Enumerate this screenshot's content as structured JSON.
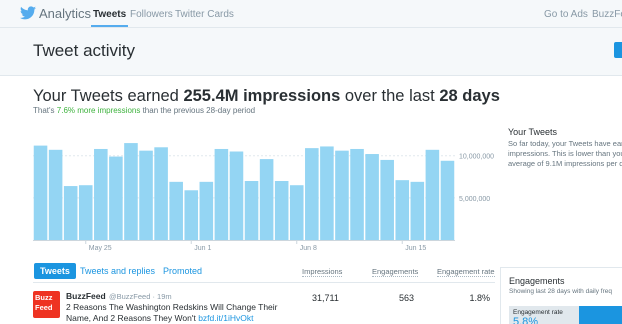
{
  "nav": {
    "brand": "Analytics",
    "tabs": [
      "Tweets",
      "Followers",
      "Twitter Cards"
    ],
    "right": [
      "Go to Ads",
      "BuzzFee"
    ]
  },
  "page": {
    "title": "Tweet activity"
  },
  "summary": {
    "prefix": "Your Tweets earned ",
    "impressions": "255.4M impressions",
    "middle": " over the last ",
    "period": "28 days",
    "compare_prefix": "That's ",
    "compare_delta": "7.6% more impressions",
    "compare_suffix": " than the previous 28-day period"
  },
  "chart_data": {
    "type": "bar",
    "ylabels": [
      "10,000,000",
      "5,000,000"
    ],
    "ytick_values": [
      10000000,
      5000000
    ],
    "xlabels": [
      "May 25",
      "Jun 1",
      "Jun 8",
      "Jun 15"
    ],
    "xlabel_positions": [
      3.5,
      10.5,
      17.5,
      24.5
    ],
    "ylim": [
      0,
      14000000
    ],
    "categories": [
      "May 22",
      "May 23",
      "May 24",
      "May 25",
      "May 26",
      "May 27",
      "May 28",
      "May 29",
      "May 30",
      "May 31",
      "Jun 1",
      "Jun 2",
      "Jun 3",
      "Jun 4",
      "Jun 5",
      "Jun 6",
      "Jun 7",
      "Jun 8",
      "Jun 9",
      "Jun 10",
      "Jun 11",
      "Jun 12",
      "Jun 13",
      "Jun 14",
      "Jun 15",
      "Jun 16",
      "Jun 17",
      "Jun 18"
    ],
    "values": [
      11200000,
      10700000,
      6400000,
      6500000,
      10800000,
      9900000,
      11500000,
      10600000,
      11000000,
      6900000,
      5900000,
      6900000,
      10800000,
      10500000,
      7000000,
      9600000,
      7000000,
      6500000,
      10900000,
      11100000,
      10600000,
      10800000,
      10200000,
      9500000,
      7100000,
      6900000,
      10700000,
      9400000
    ],
    "color": "#94d5f3",
    "grid": "horizontal"
  },
  "side": {
    "title": "Your Tweets",
    "lines": [
      "So far today, your Tweets have earn",
      "impressions. This is lower than you",
      "average of 9.1M impressions per da"
    ]
  },
  "table": {
    "tabs": [
      "Tweets",
      "Tweets and replies",
      "Promoted"
    ],
    "columns": [
      "Impressions",
      "Engagements",
      "Engagement rate"
    ]
  },
  "tweet": {
    "avatar_lines": [
      "Buzz",
      "Feed"
    ],
    "name": "BuzzFeed",
    "meta": "@BuzzFeed · 19m",
    "text": "2 Reasons The Washington Redskins Will Change Their Name, And 2 Reasons They Won't ",
    "link": "bzfd.it/1iHvOkt",
    "impressions": "31,711",
    "engagements": "563",
    "rate": "1.8%"
  },
  "engagements": {
    "title": "Engagements",
    "subtitle": "Showing last 28 days with daily freq",
    "rate_label": "Engagement rate",
    "rate_value": "5.8%"
  },
  "colors": {
    "accent": "#1b95e0",
    "bar": "#94d5f3",
    "positive": "#3db23d"
  }
}
